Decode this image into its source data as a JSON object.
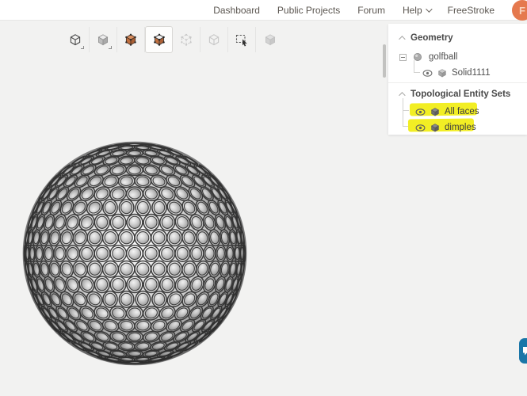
{
  "header": {
    "nav": [
      {
        "label": "Dashboard"
      },
      {
        "label": "Public Projects"
      },
      {
        "label": "Forum"
      },
      {
        "label": "Help"
      },
      {
        "label": "FreeStroke"
      }
    ],
    "avatar_initial": "F"
  },
  "toolbar": {
    "icons": [
      {
        "name": "render-mode-cube",
        "state": "enabled",
        "has_dropdown": true
      },
      {
        "name": "shaded-cube",
        "state": "enabled",
        "has_dropdown": true
      },
      {
        "name": "select-volumes-cube",
        "state": "enabled-orange"
      },
      {
        "name": "select-faces-cube",
        "state": "selected-orange"
      },
      {
        "name": "select-edges-cube",
        "state": "disabled"
      },
      {
        "name": "select-vertices-cube",
        "state": "disabled"
      },
      {
        "name": "box-select",
        "state": "enabled"
      },
      {
        "name": "invert-selection-cube",
        "state": "disabled"
      }
    ]
  },
  "scene_tree": {
    "geometry_title": "Geometry",
    "golfball_label": "golfball",
    "solid_label": "Solid1111",
    "topological_title": "Topological Entity Sets",
    "sets": [
      {
        "label": "All faces",
        "highlighted": true
      },
      {
        "label": "dimples",
        "highlighted": true
      }
    ]
  },
  "colors": {
    "avatar_orange": "#e5794e",
    "toolbar_orange": "#c9713d",
    "highlight_yellow": "#f2ee24",
    "chat_button_blue": "#1a76a8"
  }
}
